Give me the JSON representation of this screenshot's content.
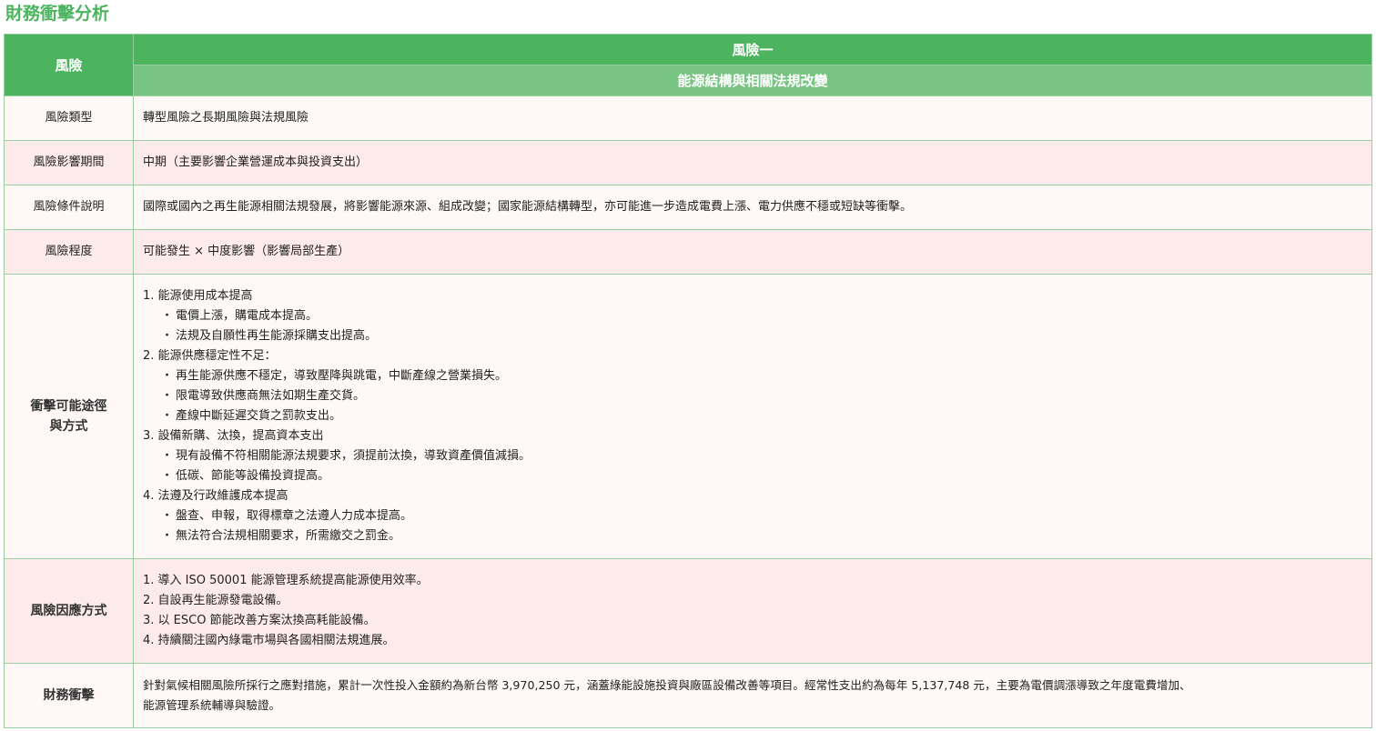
{
  "page_title": "財務衝擊分析",
  "header": {
    "risk_label": "風險",
    "risk_number": "風險一",
    "risk_name": "能源結構與相關法規改變"
  },
  "rows": {
    "risk_type": {
      "label": "風險類型",
      "value": "轉型風險之長期風險與法規風險"
    },
    "impact_period": {
      "label": "風險影響期間",
      "value": "中期（主要影響企業營運成本與投資支出）"
    },
    "condition": {
      "label": "風險條件說明",
      "value": "國際或國內之再生能源相關法規發展，將影響能源來源、組成改變；國家能源結構轉型，亦可能進一步造成電費上漲、電力供應不穩或短缺等衝擊。"
    },
    "severity": {
      "label": "風險程度",
      "value": "可能發生 × 中度影響（影響局部生產）"
    },
    "impact_paths": {
      "label_line1": "衝擊可能途徑",
      "label_line2": "與方式",
      "items": [
        {
          "title": "1. 能源使用成本提高",
          "subs": [
            "電價上漲，購電成本提高。",
            "法規及自願性再生能源採購支出提高。"
          ]
        },
        {
          "title": "2. 能源供應穩定性不足：",
          "subs": [
            "再生能源供應不穩定，導致壓降與跳電，中斷產線之營業損失。",
            "限電導致供應商無法如期生產交貨。",
            "產線中斷延遲交貨之罰款支出。"
          ]
        },
        {
          "title": "3. 設備新購、汰換，提高資本支出",
          "subs": [
            "現有設備不符相關能源法規要求，須提前汰換，導致資產價值減損。",
            "低碳、節能等設備投資提高。"
          ]
        },
        {
          "title": "4. 法遵及行政維護成本提高",
          "subs": [
            "盤查、申報，取得標章之法遵人力成本提高。",
            "無法符合法規相關要求，所需繳交之罰金。"
          ]
        }
      ]
    },
    "response": {
      "label": "風險因應方式",
      "items": [
        "1. 導入 ISO 50001 能源管理系統提高能源使用效率。",
        "2. 自設再生能源發電設備。",
        "3. 以 ESCO 節能改善方案汰換高耗能設備。",
        "4. 持續關注國內綠電市場與各國相關法規進展。"
      ]
    },
    "financial": {
      "label": "財務衝擊",
      "line1": "針對氣候相關風險所採行之應對措施，累計一次性投入金額約為新台幣 3,970,250 元，涵蓋綠能設施投資與廠區設備改善等項目。經常性支出約為每年 5,137,748 元，主要為電價調漲導致之年度電費增加、",
      "line2": "能源管理系統輔導與驗證。"
    }
  },
  "colors": {
    "title_green": "#4cb45e",
    "header_green": "#4cb45e",
    "subheader_green": "#78c483",
    "row_pink": "#fdeaea",
    "row_cream": "#fff8f6",
    "border": "#98cfa0"
  }
}
